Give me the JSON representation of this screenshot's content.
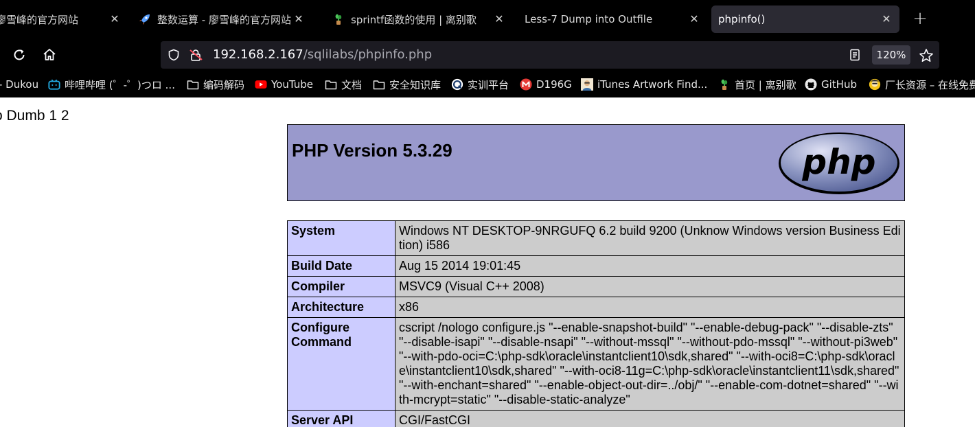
{
  "tabs": [
    {
      "title": "廖雪峰的官方网站",
      "favicon": "partial-tab-icon",
      "active": false
    },
    {
      "title": "整数运算 - 廖雪峰的官方网站",
      "favicon": "rocket-icon",
      "active": false
    },
    {
      "title": "sprintf函数的使用 | 离别歌",
      "favicon": "plant-icon",
      "active": false
    },
    {
      "title": "Less-7 Dump into Outfile",
      "favicon": "",
      "active": false
    },
    {
      "title": "phpinfo()",
      "favicon": "",
      "active": true
    }
  ],
  "newtab_label": "+",
  "address": {
    "host": "192.168.2.167",
    "path": "/sqlilabs/phpinfo.php",
    "zoom": "120%"
  },
  "bookmarks": [
    {
      "label": "- Dukou",
      "icon": ""
    },
    {
      "label": "哔哩哔哩 (゜-゜)つロ ...",
      "icon": "bilibili-icon"
    },
    {
      "label": "编码解码",
      "icon": "folder-icon"
    },
    {
      "label": "YouTube",
      "icon": "youtube-icon"
    },
    {
      "label": "文档",
      "icon": "folder-icon"
    },
    {
      "label": "安全知识库",
      "icon": "folder-icon"
    },
    {
      "label": "实训平台",
      "icon": "platform-icon"
    },
    {
      "label": "D196G",
      "icon": "m-icon"
    },
    {
      "label": "iTunes Artwork Find...",
      "icon": "avatar-icon"
    },
    {
      "label": "首页 | 离别歌",
      "icon": "plant-icon"
    },
    {
      "label": "GitHub",
      "icon": "github-icon"
    },
    {
      "label": "厂长资源 – 在线免费",
      "icon": "factory-icon"
    }
  ],
  "page": {
    "dumb_text": "o Dumb 1 2",
    "php_version": "PHP Version 5.3.29",
    "logo_text": "php",
    "rows": [
      {
        "key": "System",
        "value": "Windows NT DESKTOP-9NRGUFQ 6.2 build 9200 (Unknow Windows version Business Edition) i586"
      },
      {
        "key": "Build Date",
        "value": "Aug 15 2014 19:01:45"
      },
      {
        "key": "Compiler",
        "value": "MSVC9 (Visual C++ 2008)"
      },
      {
        "key": "Architecture",
        "value": "x86"
      },
      {
        "key": "Configure Command",
        "value": "cscript /nologo configure.js \"--enable-snapshot-build\" \"--enable-debug-pack\" \"--disable-zts\" \"--disable-isapi\" \"--disable-nsapi\" \"--without-mssql\" \"--without-pdo-mssql\" \"--without-pi3web\" \"--with-pdo-oci=C:\\php-sdk\\oracle\\instantclient10\\sdk,shared\" \"--with-oci8=C:\\php-sdk\\oracle\\instantclient10\\sdk,shared\" \"--with-oci8-11g=C:\\php-sdk\\oracle\\instantclient11\\sdk,shared\" \"--with-enchant=shared\" \"--enable-object-out-dir=../obj/\" \"--enable-com-dotnet=shared\" \"--with-mcrypt=static\" \"--disable-static-analyze\""
      },
      {
        "key": "Server API",
        "value": "CGI/FastCGI"
      }
    ]
  },
  "colors": {
    "chrome_bg": "#000000",
    "urlbar_bg": "#1c1b22",
    "active_tab_bg": "#2b2a33",
    "php_header": "#9999cc",
    "key_cell": "#ccccff",
    "value_cell": "#cccccc"
  }
}
